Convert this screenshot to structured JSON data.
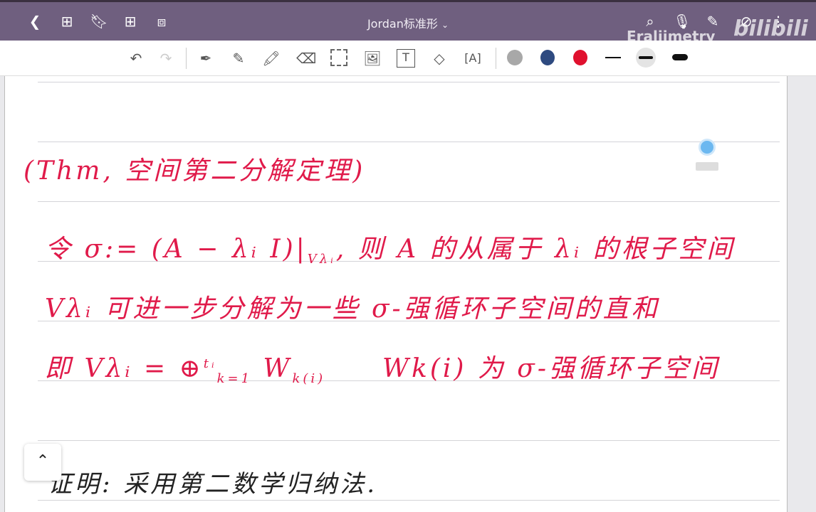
{
  "header": {
    "title": "Jordan标准形",
    "watermark": "Eraliimetry",
    "bili_logo": "bilibili"
  },
  "toolbar": {
    "colors": {
      "gray": "#a8a8a8",
      "navy": "#2e4a80",
      "red": "#e0102e",
      "black": "#111111"
    }
  },
  "note": {
    "heading": "(Thm, 空间第二分解定理)",
    "line1": "令 σ:= (A − λᵢ I)|",
    "line1_sub": "Vλᵢ",
    "line1_rest": ", 则 A 的从属于 λᵢ 的根子空间",
    "line2": "Vλᵢ 可进一步分解为一些 σ-强循环子空间的直和",
    "line3a": "即 Vλᵢ = ⊕",
    "line3_sup": "tᵢ",
    "line3_sub": "k=1",
    "line3b": "W",
    "line3b_idx": "k(i)",
    "line3c": "Wk(i) 为 σ-强循环子空间",
    "proof": "证明: 采用第二数学归纳法."
  }
}
